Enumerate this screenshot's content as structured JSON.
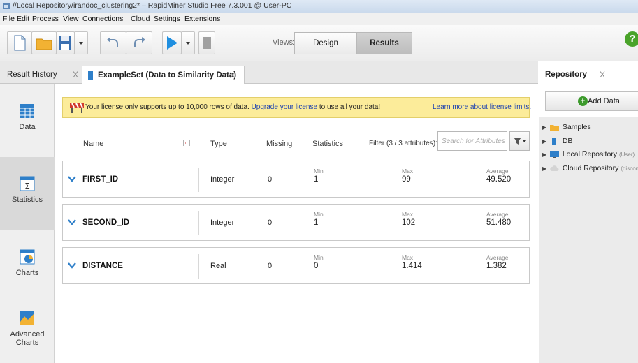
{
  "titlebar": {
    "text": "//Local Repository/irandoc_clustering2* – RapidMiner Studio Free 7.3.001 @ User-PC"
  },
  "menu": [
    "File",
    "Edit",
    "Process",
    "View",
    "Connections",
    "Cloud",
    "Settings",
    "Extensions"
  ],
  "toolbar": {
    "icons": [
      "new-process-icon",
      "open-folder-icon",
      "save-icon",
      "save-dropdown-icon",
      "undo-icon",
      "redo-icon",
      "run-icon",
      "run-dropdown-icon",
      "stop-icon"
    ],
    "views_label": "Views:",
    "design_label": "Design",
    "results_label": "Results",
    "help_label": "?"
  },
  "tabs": {
    "result_history": "Result History",
    "exampleset": "ExampleSet (Data to Similarity Data)",
    "close": "X"
  },
  "nav": [
    {
      "label": "Data",
      "icon": "table-icon"
    },
    {
      "label": "Statistics",
      "icon": "statistics-icon"
    },
    {
      "label": "Charts",
      "icon": "charts-icon"
    },
    {
      "label": "Advanced\nCharts",
      "icon": "advanced-charts-icon"
    }
  ],
  "license": {
    "text": "Your license only supports up to 10,000 rows of data.",
    "upgrade_link": "Upgrade your license",
    "text_after": "to use all your data!",
    "learn_more": "Learn more about license limits."
  },
  "table": {
    "headers": {
      "name": "Name",
      "type": "Type",
      "missing": "Missing",
      "statistics": "Statistics",
      "filter": "Filter (3 / 3 attributes):"
    },
    "search_placeholder": "Search for Attributes",
    "stat_labels": {
      "min": "Min",
      "max": "Max",
      "average": "Average"
    },
    "rows": [
      {
        "name": "FIRST_ID",
        "type": "Integer",
        "missing": "0",
        "min": "1",
        "max": "99",
        "average": "49.520"
      },
      {
        "name": "SECOND_ID",
        "type": "Integer",
        "missing": "0",
        "min": "1",
        "max": "102",
        "average": "51.480"
      },
      {
        "name": "DISTANCE",
        "type": "Real",
        "missing": "0",
        "min": "0",
        "max": "1.414",
        "average": "1.382"
      }
    ]
  },
  "repository": {
    "tab_label": "Repository",
    "close": "X",
    "add_data_label": "Add Data",
    "tree": [
      {
        "label": "Samples",
        "sub": "",
        "icon": "folder-icon"
      },
      {
        "label": "DB",
        "sub": "",
        "icon": "database-icon"
      },
      {
        "label": "Local Repository",
        "sub": "(User)",
        "icon": "local-repository-icon"
      },
      {
        "label": "Cloud Repository",
        "sub": "(disconnect",
        "icon": "cloud-repository-icon"
      }
    ]
  },
  "colors": {
    "license_bg": "#fcec9a",
    "link": "#1a3fb0",
    "accent_blue": "#2e7fc9",
    "add_green": "#3c9a2c"
  }
}
